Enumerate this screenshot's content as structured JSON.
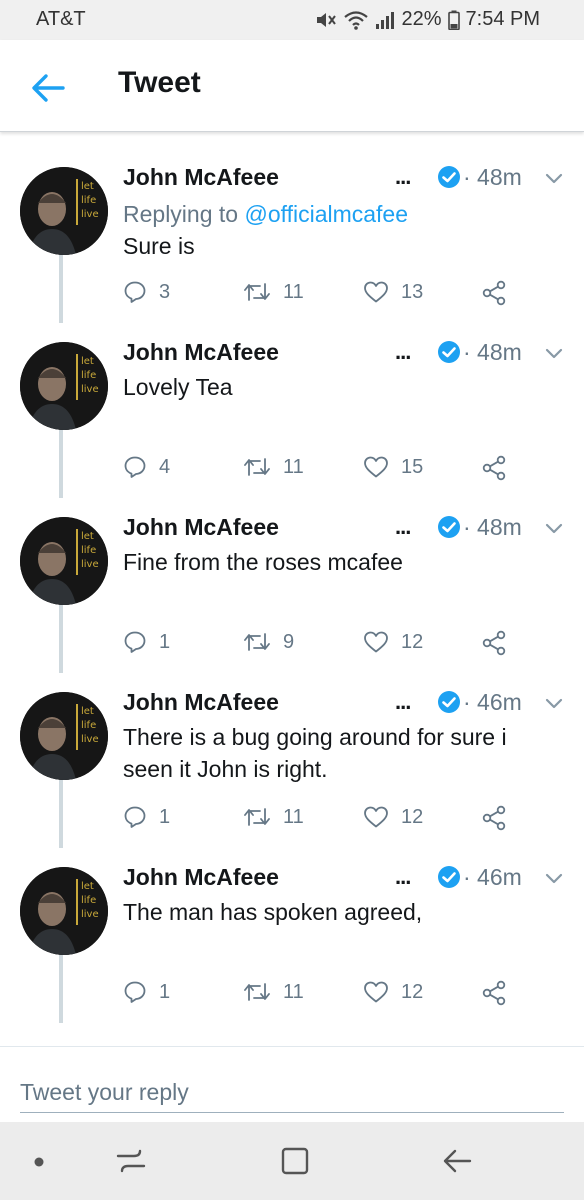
{
  "status_bar": {
    "carrier": "AT&T",
    "battery": "22%",
    "time": "7:54 PM"
  },
  "header": {
    "title": "Tweet",
    "accent_color": "#1da1f2"
  },
  "tweets": [
    {
      "author": "John McAfeee",
      "more": "...",
      "time": "· 48m",
      "reply_prefix": "Replying to ",
      "reply_handle": "@officialmcafee",
      "text": "Sure is",
      "replies": "3",
      "retweets": "11",
      "likes": "13"
    },
    {
      "author": "John McAfeee",
      "more": "...",
      "time": "· 48m",
      "text": "Lovely Tea",
      "replies": "4",
      "retweets": "11",
      "likes": "15"
    },
    {
      "author": "John McAfeee",
      "more": "...",
      "time": "· 48m",
      "text": "Fine from the roses mcafee",
      "replies": "1",
      "retweets": "9",
      "likes": "12"
    },
    {
      "author": "John McAfeee",
      "more": "...",
      "time": "· 46m",
      "text": "There is a bug going around for sure i seen it John is right.",
      "replies": "1",
      "retweets": "11",
      "likes": "12"
    },
    {
      "author": "John McAfeee",
      "more": "...",
      "time": "· 46m",
      "text": "The man has spoken agreed,",
      "replies": "1",
      "retweets": "11",
      "likes": "12"
    }
  ],
  "reply_bar": {
    "placeholder": "Tweet your reply"
  },
  "avatar_caption": [
    "let",
    "life",
    "live"
  ]
}
